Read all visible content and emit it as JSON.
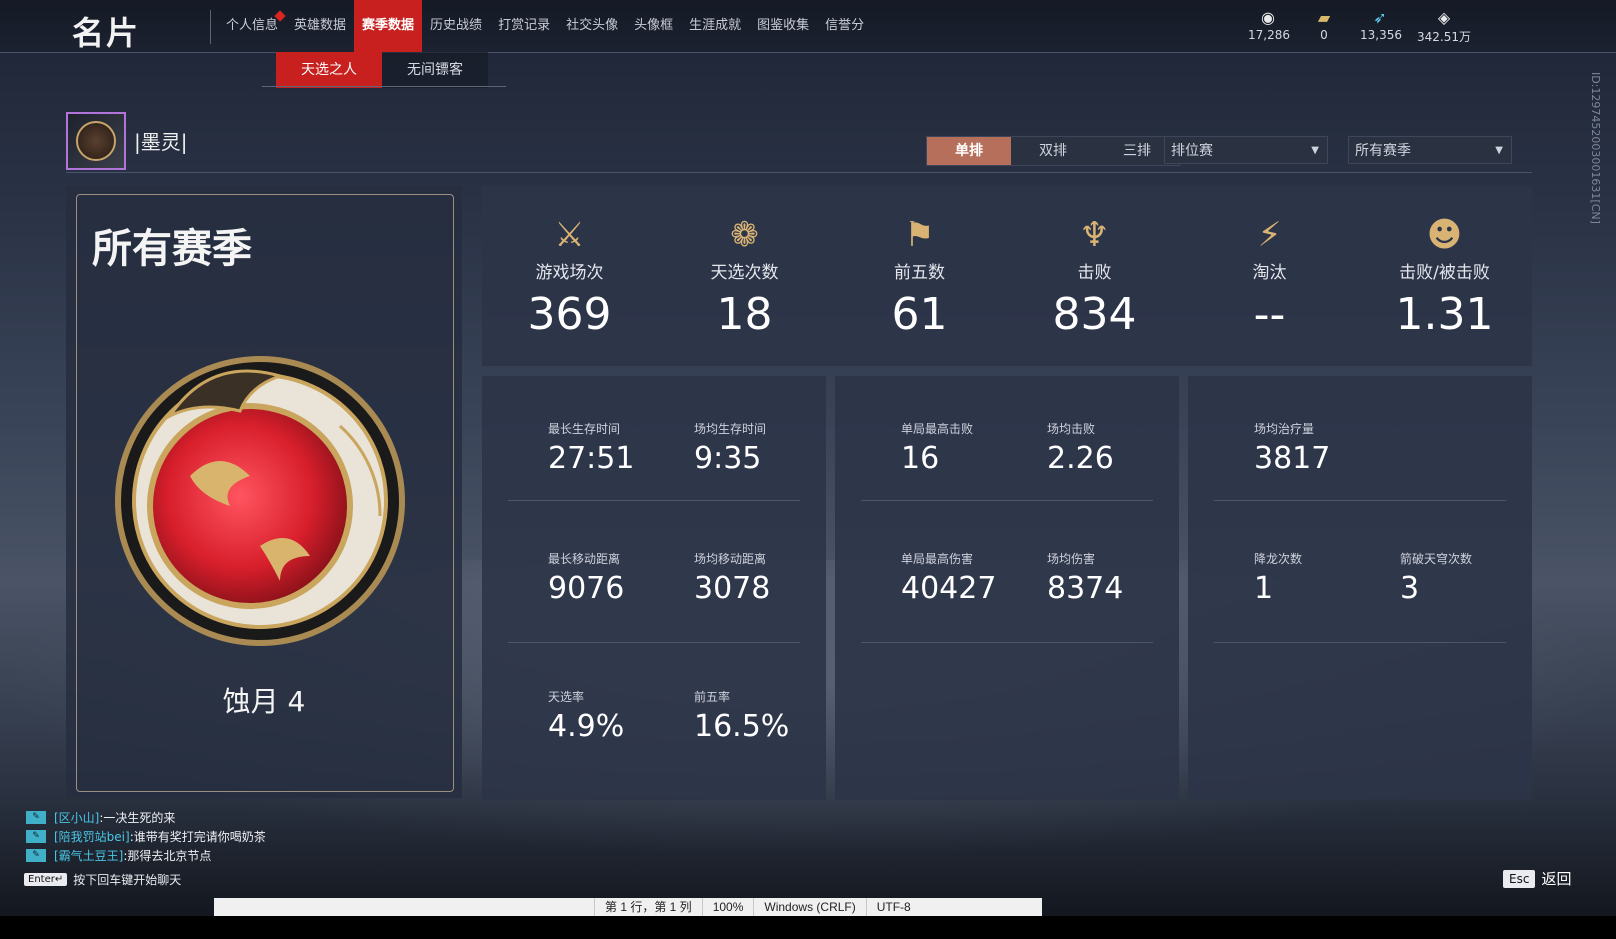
{
  "brand": "名片",
  "nav": [
    {
      "label": "个人信息",
      "badge": true
    },
    {
      "label": "英雄数据"
    },
    {
      "label": "赛季数据",
      "active": true
    },
    {
      "label": "历史战绩"
    },
    {
      "label": "打赏记录"
    },
    {
      "label": "社交头像"
    },
    {
      "label": "头像框"
    },
    {
      "label": "生涯成就"
    },
    {
      "label": "图鉴收集"
    },
    {
      "label": "信誉分"
    }
  ],
  "subnav": [
    {
      "label": "天选之人",
      "active": true
    },
    {
      "label": "无间镖客"
    }
  ],
  "currencies": [
    {
      "icon": "eye-coin-icon",
      "value": "17,286"
    },
    {
      "icon": "gold-ticket-icon",
      "value": "0"
    },
    {
      "icon": "feather-coin-icon",
      "value": "13,356"
    },
    {
      "icon": "diamond-icon",
      "value": "342.51万"
    }
  ],
  "player_id": "ID:1297452003001631[CN]",
  "player": {
    "name": "|墨灵|"
  },
  "modes": [
    {
      "label": "单排",
      "active": true
    },
    {
      "label": "双排"
    },
    {
      "label": "三排"
    }
  ],
  "selects": {
    "match_type": "排位赛",
    "season": "所有赛季"
  },
  "season": {
    "title": "所有赛季",
    "rank": "蚀月 4"
  },
  "overview": [
    {
      "icon": "crossed-swords-icon",
      "label": "游戏场次",
      "value": "369"
    },
    {
      "icon": "lotus-crest-icon",
      "label": "天选次数",
      "value": "18"
    },
    {
      "icon": "banner-icon",
      "label": "前五数",
      "value": "61"
    },
    {
      "icon": "trident-icon",
      "label": "击败",
      "value": "834"
    },
    {
      "icon": "broken-blade-icon",
      "label": "淘汰",
      "value": "--"
    },
    {
      "icon": "mask-icon",
      "label": "击败/被击败",
      "value": "1.31"
    }
  ],
  "panel1": [
    {
      "label": "最长生存时间",
      "value": "27:51"
    },
    {
      "label": "场均生存时间",
      "value": "9:35"
    },
    {
      "label": "最长移动距离",
      "value": "9076"
    },
    {
      "label": "场均移动距离",
      "value": "3078"
    },
    {
      "label": "天选率",
      "value": "4.9%"
    },
    {
      "label": "前五率",
      "value": "16.5%"
    }
  ],
  "panel2": [
    {
      "label": "单局最高击败",
      "value": "16"
    },
    {
      "label": "场均击败",
      "value": "2.26"
    },
    {
      "label": "单局最高伤害",
      "value": "40427"
    },
    {
      "label": "场均伤害",
      "value": "8374"
    }
  ],
  "panel3": [
    {
      "label": "场均治疗量",
      "value": "3817"
    },
    {
      "label": "降龙次数",
      "value": "1"
    },
    {
      "label": "箭破天穹次数",
      "value": "3"
    }
  ],
  "chat": [
    {
      "name": "[区小山]",
      "msg": ":一决生死的来"
    },
    {
      "name": "[陪我罚站bei]",
      "msg": ":谁带有奖打完请你喝奶茶"
    },
    {
      "name": "[霸气土豆王]",
      "msg": ":那得去北京节点"
    }
  ],
  "enter_key": "Enter↵",
  "enter_hint": "按下回车键开始聊天",
  "esc_key": "Esc",
  "esc_label": "返回",
  "statusbar": [
    "第 1 行，第 1 列",
    "100%",
    "Windows (CRLF)",
    "UTF-8"
  ]
}
